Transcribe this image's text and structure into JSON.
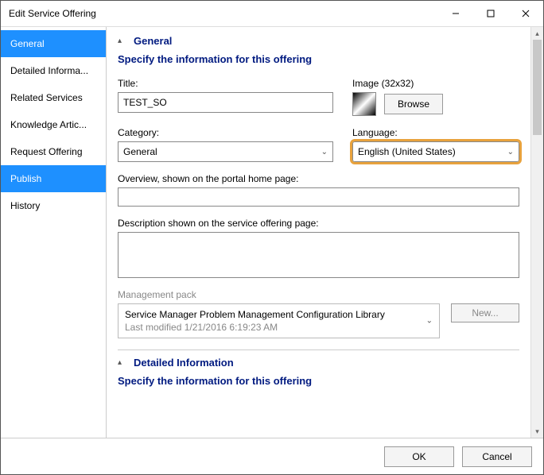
{
  "window": {
    "title": "Edit Service Offering"
  },
  "sidebar": {
    "items": [
      {
        "label": "General"
      },
      {
        "label": "Detailed Informa..."
      },
      {
        "label": "Related Services"
      },
      {
        "label": "Knowledge Artic..."
      },
      {
        "label": "Request Offering"
      },
      {
        "label": "Publish"
      },
      {
        "label": "History"
      }
    ]
  },
  "general": {
    "header": "General",
    "subheader": "Specify the information for this offering",
    "title_label": "Title:",
    "title_value": "TEST_SO",
    "image_label": "Image (32x32)",
    "browse_label": "Browse",
    "category_label": "Category:",
    "category_value": "General",
    "language_label": "Language:",
    "language_value": "English (United States)",
    "overview_label": "Overview, shown on the portal home page:",
    "overview_value": "",
    "description_label": "Description shown on the service offering page:",
    "description_value": "",
    "mgmt_label": "Management pack",
    "mgmt_name": "Service Manager Problem Management Configuration Library",
    "mgmt_modified": "Last modified  1/21/2016 6:19:23 AM",
    "new_label": "New..."
  },
  "detailed": {
    "header": "Detailed Information",
    "subheader": "Specify the information for this offering"
  },
  "buttons": {
    "ok": "OK",
    "cancel": "Cancel"
  }
}
